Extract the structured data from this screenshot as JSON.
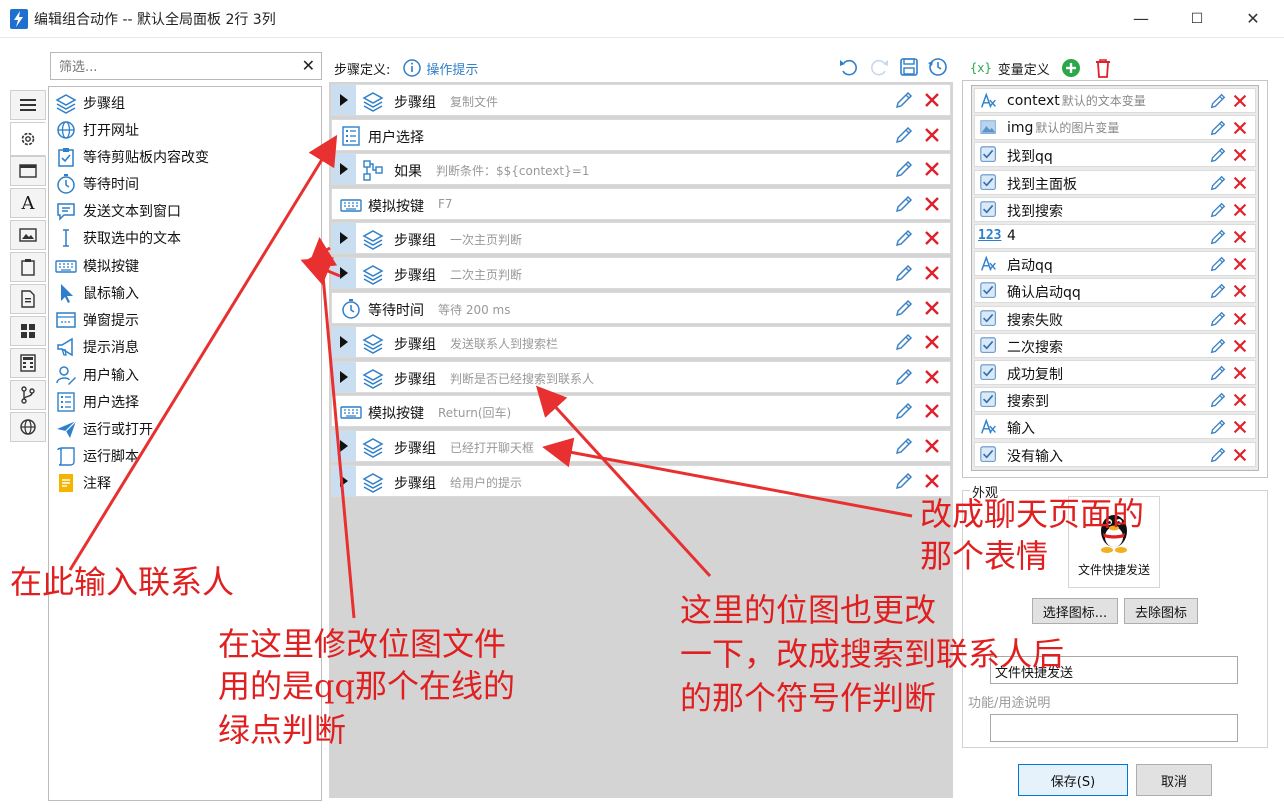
{
  "window": {
    "title": "编辑组合动作 -- 默认全局面板 2行 3列",
    "minimize": "—",
    "maximize": "☐",
    "close": "✕"
  },
  "palette": {
    "filter_placeholder": "筛选...",
    "items": [
      {
        "label": "步骤组",
        "icon": "layers-icon"
      },
      {
        "label": "打开网址",
        "icon": "globe-icon"
      },
      {
        "label": "等待剪贴板内容改变",
        "icon": "clipboard-check-icon"
      },
      {
        "label": "等待时间",
        "icon": "stopwatch-icon"
      },
      {
        "label": "发送文本到窗口",
        "icon": "chat-bubble-icon"
      },
      {
        "label": "获取选中的文本",
        "icon": "text-cursor-icon"
      },
      {
        "label": "模拟按键",
        "icon": "keyboard-icon"
      },
      {
        "label": "鼠标输入",
        "icon": "mouse-pointer-icon"
      },
      {
        "label": "弹窗提示",
        "icon": "popup-window-icon"
      },
      {
        "label": "提示消息",
        "icon": "megaphone-icon"
      },
      {
        "label": "用户输入",
        "icon": "user-edit-icon"
      },
      {
        "label": "用户选择",
        "icon": "list-select-icon"
      },
      {
        "label": "运行或打开",
        "icon": "paper-plane-icon"
      },
      {
        "label": "运行脚本",
        "icon": "script-scroll-icon"
      },
      {
        "label": "注释",
        "icon": "note-icon"
      }
    ]
  },
  "steps": {
    "header_label": "步骤定义:",
    "hint_link": "操作提示",
    "toolbar": [
      "undo-icon",
      "redo-icon",
      "save-icon",
      "history-icon"
    ],
    "rows": [
      {
        "label": "步骤组",
        "desc": "复制文件",
        "icon": "layers-icon",
        "expandable": true
      },
      {
        "label": "用户选择",
        "desc": "",
        "icon": "list-select-icon",
        "expandable": false
      },
      {
        "label": "如果",
        "desc": "判断条件：$${context}=1",
        "icon": "branch-icon",
        "expandable": true
      },
      {
        "label": "模拟按键",
        "desc": "F7",
        "icon": "keyboard-icon",
        "expandable": false
      },
      {
        "label": "步骤组",
        "desc": "一次主页判断",
        "icon": "layers-icon",
        "expandable": true
      },
      {
        "label": "步骤组",
        "desc": "二次主页判断",
        "icon": "layers-icon",
        "expandable": true
      },
      {
        "label": "等待时间",
        "desc": "等待 200 ms",
        "icon": "stopwatch-icon",
        "expandable": false
      },
      {
        "label": "步骤组",
        "desc": "发送联系人到搜索栏",
        "icon": "layers-icon",
        "expandable": true
      },
      {
        "label": "步骤组",
        "desc": "判断是否已经搜索到联系人",
        "icon": "layers-icon",
        "expandable": true
      },
      {
        "label": "模拟按键",
        "desc": "Return(回车)",
        "icon": "keyboard-icon",
        "expandable": false
      },
      {
        "label": "步骤组",
        "desc": "已经打开聊天框",
        "icon": "layers-icon",
        "expandable": true
      },
      {
        "label": "步骤组",
        "desc": "给用户的提示",
        "icon": "layers-icon",
        "expandable": true
      }
    ]
  },
  "variables": {
    "header_label": "变量定义",
    "header_badge": "{x}",
    "items": [
      {
        "name": "context",
        "desc": "默认的文本变量",
        "icon": "text-variable-icon"
      },
      {
        "name": "img",
        "desc": "默认的图片变量",
        "icon": "image-variable-icon"
      },
      {
        "name": "找到qq",
        "desc": "",
        "icon": "checkbox-icon"
      },
      {
        "name": "找到主面板",
        "desc": "",
        "icon": "checkbox-icon"
      },
      {
        "name": "找到搜索",
        "desc": "",
        "icon": "checkbox-icon"
      },
      {
        "name": "4",
        "desc": "",
        "icon": "number-icon"
      },
      {
        "name": "启动qq",
        "desc": "",
        "icon": "text-variable-icon"
      },
      {
        "name": "确认启动qq",
        "desc": "",
        "icon": "checkbox-icon"
      },
      {
        "name": "搜索失败",
        "desc": "",
        "icon": "checkbox-icon"
      },
      {
        "name": "二次搜索",
        "desc": "",
        "icon": "checkbox-icon"
      },
      {
        "name": "成功复制",
        "desc": "",
        "icon": "checkbox-icon"
      },
      {
        "name": "搜索到",
        "desc": "",
        "icon": "checkbox-icon"
      },
      {
        "name": "输入",
        "desc": "",
        "icon": "text-variable-icon"
      },
      {
        "name": "没有输入",
        "desc": "",
        "icon": "checkbox-icon"
      }
    ],
    "number_icon_text": "123"
  },
  "appearance": {
    "section_title": "外观",
    "preview_label": "文件快捷发送",
    "choose_icon_button": "选择图标...",
    "remove_icon_button": "去除图标",
    "name_value": "文件快捷发送",
    "function_label": "功能/用途说明",
    "function_value": ""
  },
  "dialog_buttons": {
    "save": "保存(S)",
    "cancel": "取消"
  },
  "annotations": {
    "enter_contact": "在此输入联系人",
    "modify_bitmap": [
      "在这里修改位图文件",
      "用的是qq那个在线的",
      "绿点判断"
    ],
    "change_chat_emoji": [
      "改成聊天页面的",
      "那个表情"
    ],
    "change_bitmap_here": [
      "这里的位图也更改",
      "一下，改成搜索到联系人后",
      "的那个符号作判断"
    ]
  },
  "colors": {
    "accent_blue": "#2f7fc9",
    "delete_red": "#e0202a",
    "annotation_red": "#e83030",
    "expander_blue": "#c9dff1",
    "add_green": "#2aa748"
  }
}
